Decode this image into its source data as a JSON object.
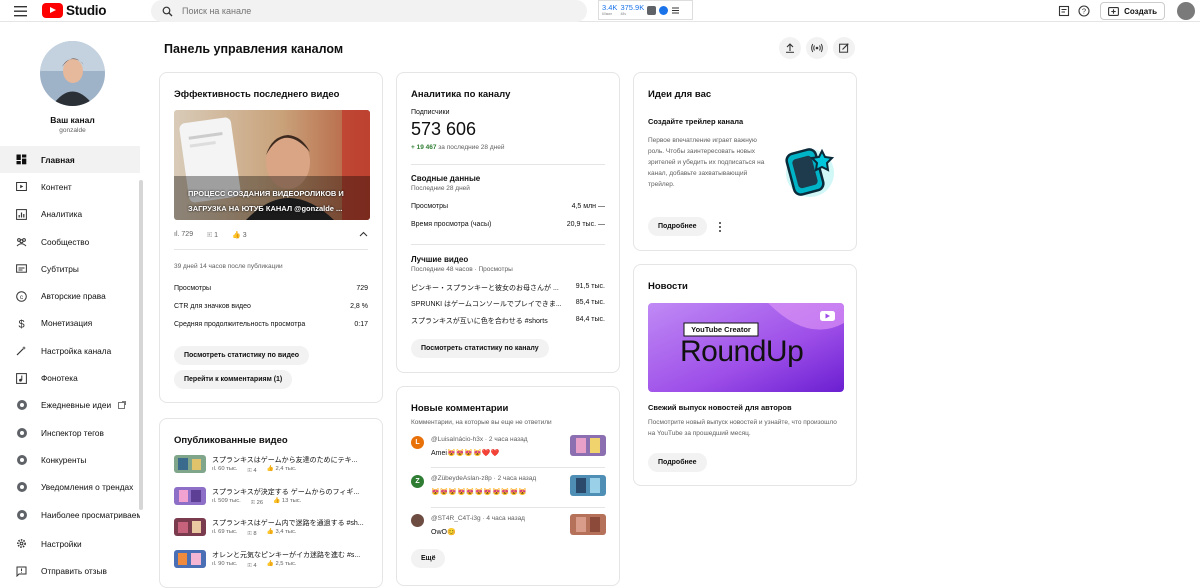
{
  "topbar": {
    "logo_text": "Studio",
    "search_placeholder": "Поиск на канале",
    "stats": [
      {
        "value": "3.4K",
        "label": "60мин"
      },
      {
        "value": "375.9K",
        "label": "48ч"
      }
    ],
    "create_label": "Создать"
  },
  "sidebar": {
    "channel_title": "Ваш канал",
    "channel_handle": "gonzalde",
    "items": [
      {
        "label": "Главная",
        "icon": "dashboard-icon",
        "active": true
      },
      {
        "label": "Контент",
        "icon": "content-icon"
      },
      {
        "label": "Аналитика",
        "icon": "analytics-icon"
      },
      {
        "label": "Сообщество",
        "icon": "community-icon"
      },
      {
        "label": "Субтитры",
        "icon": "subtitles-icon"
      },
      {
        "label": "Авторские права",
        "icon": "copyright-icon"
      },
      {
        "label": "Монетизация",
        "icon": "monetization-icon"
      },
      {
        "label": "Настройка канала",
        "icon": "customization-icon"
      },
      {
        "label": "Фонотека",
        "icon": "audio-library-icon"
      },
      {
        "label": "Ежедневные идеи",
        "icon": "extension-icon"
      },
      {
        "label": "Инспектор тегов",
        "icon": "extension-icon"
      },
      {
        "label": "Конкуренты",
        "icon": "extension-icon"
      },
      {
        "label": "Уведомления о трендах",
        "icon": "extension-icon"
      },
      {
        "label": "Наиболее просматриваемые",
        "icon": "extension-icon"
      },
      {
        "label": "Настройки",
        "icon": "settings-icon"
      },
      {
        "label": "Отправить отзыв",
        "icon": "feedback-icon"
      }
    ]
  },
  "page": {
    "title": "Панель управления каналом"
  },
  "latest_video": {
    "title": "Эффективность последнего видео",
    "overlay": "ПРОЦЕСС СОЗДАНИЯ ВИДЕОРОЛИКОВ И ЗАГРУЗКА НА ЮТУБ КАНАЛ @gonzalde ...",
    "views": "729",
    "comments": "1",
    "likes": "3",
    "since": "39 дней 14 часов после публикации",
    "metrics": [
      {
        "label": "Просмотры",
        "value": "729"
      },
      {
        "label": "CTR для значков видео",
        "value": "2,8 %"
      },
      {
        "label": "Средняя продолжительность просмотра",
        "value": "0:17"
      }
    ],
    "stats_btn": "Посмотреть статистику по видео",
    "comments_btn": "Перейти к комментариям (1)"
  },
  "analytics": {
    "title": "Аналитика по каналу",
    "subs_label": "Подписчики",
    "subs_value": "573 606",
    "subs_change": "+ 19 467",
    "subs_change_note": "за последние 28 дней",
    "summary_title": "Сводные данные",
    "summary_sub": "Последние 28 дней",
    "summary": [
      {
        "label": "Просмотры",
        "value": "4,5 млн"
      },
      {
        "label": "Время просмотра (часы)",
        "value": "20,9 тыс."
      }
    ],
    "top_title": "Лучшие видео",
    "top_sub": "Последние 48 часов · Просмотры",
    "top": [
      {
        "title": "ピンキー・スプランキーと彼女のお母さんが ...",
        "value": "91,5 тыс."
      },
      {
        "title": "SPRUNKI はゲームコンソールでプレイできま...",
        "value": "85,4 тыс."
      },
      {
        "title": "スプランキスが互いに色を合わせる #shorts",
        "value": "84,4 тыс."
      }
    ],
    "button": "Посмотреть статистику по каналу"
  },
  "ideas": {
    "title": "Идеи для вас",
    "sub": "Создайте трейлер канала",
    "text": "Первое впечатление играет важную роль. Чтобы заинтересовать новых зрителей и убедить их подписаться на канал, добавьте захватывающий трейлер.",
    "button": "Подробнее"
  },
  "news": {
    "title": "Новости",
    "banner_small": "YouTube Creator",
    "banner_big": "RoundUp",
    "headline": "Свежий выпуск новостей для авторов",
    "text": "Посмотрите новый выпуск новостей и узнайте, что произошло на YouTube за прошедший месяц.",
    "button": "Подробнее"
  },
  "published": {
    "title": "Опубликованные видео",
    "items": [
      {
        "title": "スプランキスはゲームから友達のためにテキ...",
        "views": "60 тыс.",
        "comments": "4",
        "likes": "2,4 тыс."
      },
      {
        "title": "スプランキスが決定する ゲームからのフィギ...",
        "views": "509 тыс.",
        "comments": "26",
        "likes": "13 тыс."
      },
      {
        "title": "スプランキスはゲーム内で迷路を通過する #sh...",
        "views": "69 тыс.",
        "comments": "8",
        "likes": "3,4 тыс."
      },
      {
        "title": "オレンと元気なピンキーがイカ迷路を進む #s...",
        "views": "90 тыс.",
        "comments": "4",
        "likes": "2,5 тыс."
      }
    ]
  },
  "comments": {
    "title": "Новые комментарии",
    "sub": "Комментарии, на которые вы еще не ответили",
    "items": [
      {
        "letter": "L",
        "color": "#e8710a",
        "author": "@LuisaInácio-h3x · 2 часа назад",
        "text": "Amei😻😻😻😻❤️❤️"
      },
      {
        "letter": "Z",
        "color": "#2e7d32",
        "author": "@ZübeydeAslan-z8p · 2 часа назад",
        "text": "😻😻😻😻😻😻😻😻😻😻😻"
      },
      {
        "letter": "",
        "color": "#6d4c41",
        "author": "@ST4R_C4T-i3g · 4 часа назад",
        "text": "OwO😊"
      }
    ],
    "more": "Ещё"
  }
}
